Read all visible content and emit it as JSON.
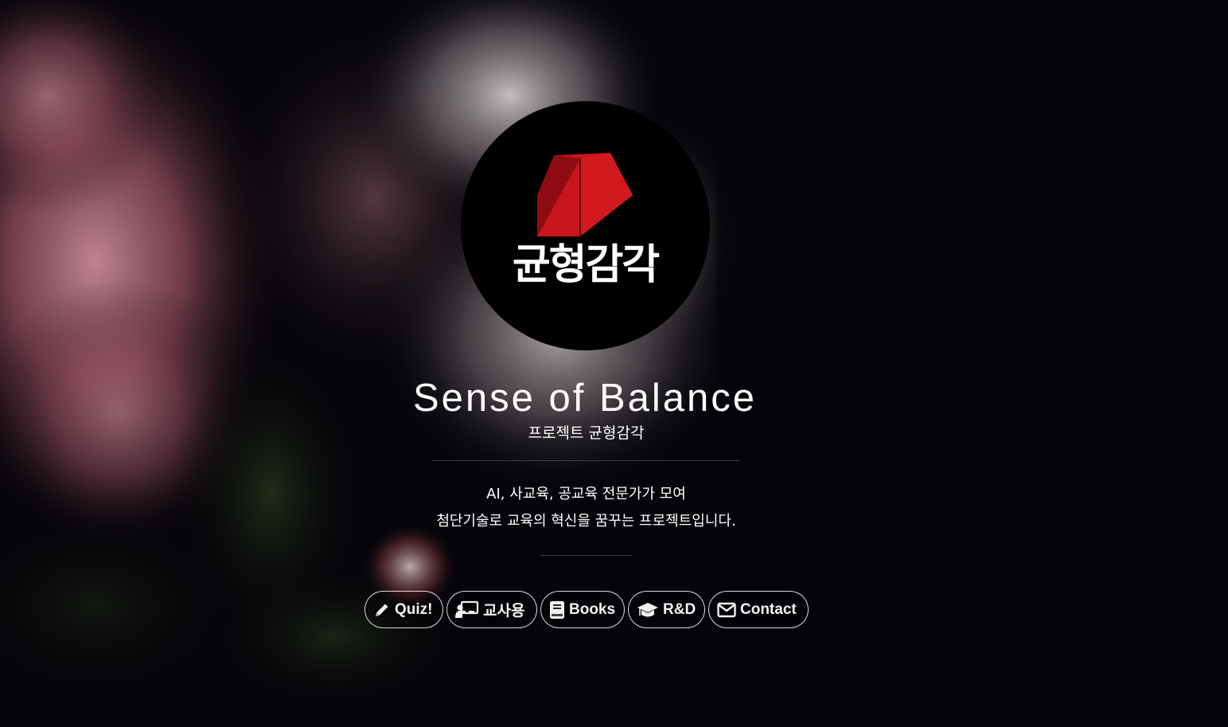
{
  "logo": {
    "wordmark": "균형감각",
    "colors": {
      "background": "#000000",
      "roof": "#c8151b",
      "roof_dark": "#8f0d12",
      "text": "#ffffff"
    }
  },
  "header": {
    "title": "Sense of Balance",
    "subtitle": "프로젝트 균형감각"
  },
  "description": {
    "line1": "AI, 사교육, 공교육 전문가가 모여",
    "line2": "첨단기술로 교육의 혁신을 꿈꾸는 프로젝트입니다."
  },
  "nav": {
    "items": [
      {
        "label": "Quiz!",
        "icon": "pencil-icon"
      },
      {
        "label": "교사용",
        "icon": "chalkboard-teacher-icon"
      },
      {
        "label": "Books",
        "icon": "book-icon"
      },
      {
        "label": "R&D",
        "icon": "graduation-cap-icon"
      },
      {
        "label": "Contact",
        "icon": "envelope-icon"
      }
    ]
  },
  "theme": {
    "page_background": "#050409",
    "text": "#ffffff",
    "button_border": "#ffffff"
  }
}
